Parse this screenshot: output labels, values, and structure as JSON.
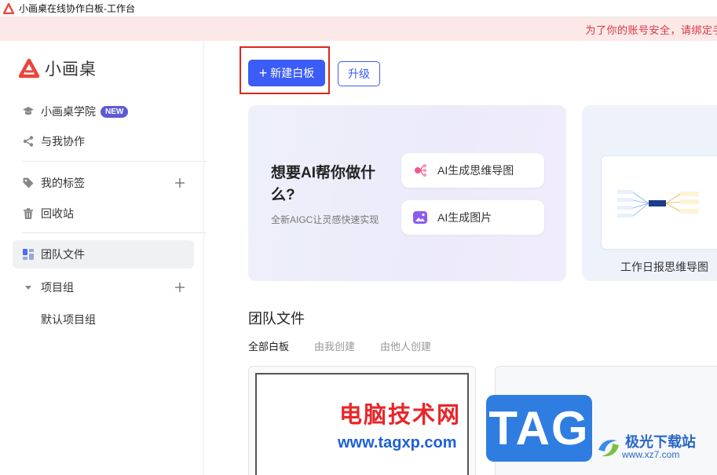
{
  "window": {
    "title": "小画桌在线协作白板-工作台"
  },
  "banner": {
    "text": "为了你的账号安全，请绑定手"
  },
  "sidebar": {
    "logo_text": "小画桌",
    "academy": {
      "label": "小画桌学院",
      "badge": "NEW"
    },
    "shared": {
      "label": "与我协作"
    },
    "tags": {
      "label": "我的标签"
    },
    "trash": {
      "label": "回收站"
    },
    "team_files": {
      "label": "团队文件"
    },
    "project_group": {
      "label": "项目组"
    },
    "default_project": {
      "label": "默认项目组"
    }
  },
  "toolbar": {
    "new_board_label": "新建白板",
    "upgrade_label": "升级"
  },
  "ai_card": {
    "headline": "想要AI帮你做什么?",
    "subtitle": "全新AIGC让灵感快速实现",
    "mindmap_label": "AI生成思维导图",
    "image_label": "AI生成图片"
  },
  "template_card": {
    "label": "工作日报思维导图"
  },
  "section": {
    "title": "团队文件"
  },
  "tabs": [
    {
      "label": "全部白板",
      "active": true
    },
    {
      "label": "由我创建",
      "active": false
    },
    {
      "label": "由他人创建",
      "active": false
    }
  ],
  "watermark": {
    "text": "电脑技术网",
    "url": "www.tagxp.com",
    "tag": "TAG",
    "site_name": "极光下载站",
    "site_url": "www.xz7.com"
  },
  "colors": {
    "primary": "#3c5cf6",
    "highlight": "#e0261c",
    "banner_bg": "#fde8e8",
    "banner_text": "#d9363e",
    "logo": "#e9453b"
  },
  "icons": {
    "logo": "red-triangle-logo-icon",
    "academy": "graduation-cap-icon",
    "shared": "share-icon",
    "tags": "tag-icon",
    "trash": "trash-icon",
    "team_files": "team-files-icon",
    "project_group": "caret-down-icon",
    "add": "plus-icon",
    "mindmap": "mindmap-icon",
    "image": "image-icon"
  }
}
